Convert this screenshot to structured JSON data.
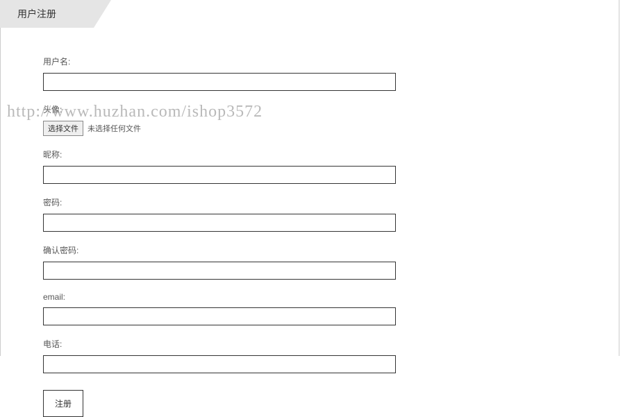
{
  "header": {
    "title": "用户注册"
  },
  "form": {
    "username_label": "用户名:",
    "avatar_label": "头像:",
    "file_button": "选择文件",
    "file_status": "未选择任何文件",
    "nickname_label": "昵称:",
    "password_label": "密码:",
    "confirm_password_label": "确认密码:",
    "email_label": "email:",
    "phone_label": "电话:",
    "submit_label": "注册"
  },
  "watermark": "http://www.huzhan.com/ishop3572"
}
